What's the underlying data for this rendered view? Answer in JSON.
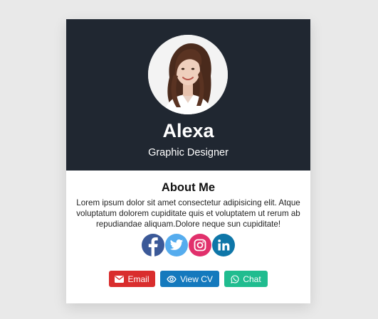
{
  "profile": {
    "name": "Alexa",
    "title": "Graphic Designer"
  },
  "about": {
    "heading": "About Me",
    "text": "Lorem ipsum dolor sit amet consectetur adipisicing elit. Atque voluptatum dolorem cupiditate quis et voluptatem ut rerum ab repudiandae aliquam.Dolore neque sun cupiditate!"
  },
  "socials": [
    {
      "icon": "facebook-icon",
      "color": "#3b5998"
    },
    {
      "icon": "twitter-icon",
      "color": "#55acee"
    },
    {
      "icon": "instagram-icon",
      "color": "#e1306c"
    },
    {
      "icon": "linkedin-icon",
      "color": "#0e76a8"
    }
  ],
  "buttons": {
    "email": "Email",
    "view_cv": "View CV",
    "chat": "Chat"
  },
  "colors": {
    "header_bg": "#202731",
    "email": "#d92d2d",
    "view_cv": "#1479bd",
    "chat": "#20bc8f"
  }
}
